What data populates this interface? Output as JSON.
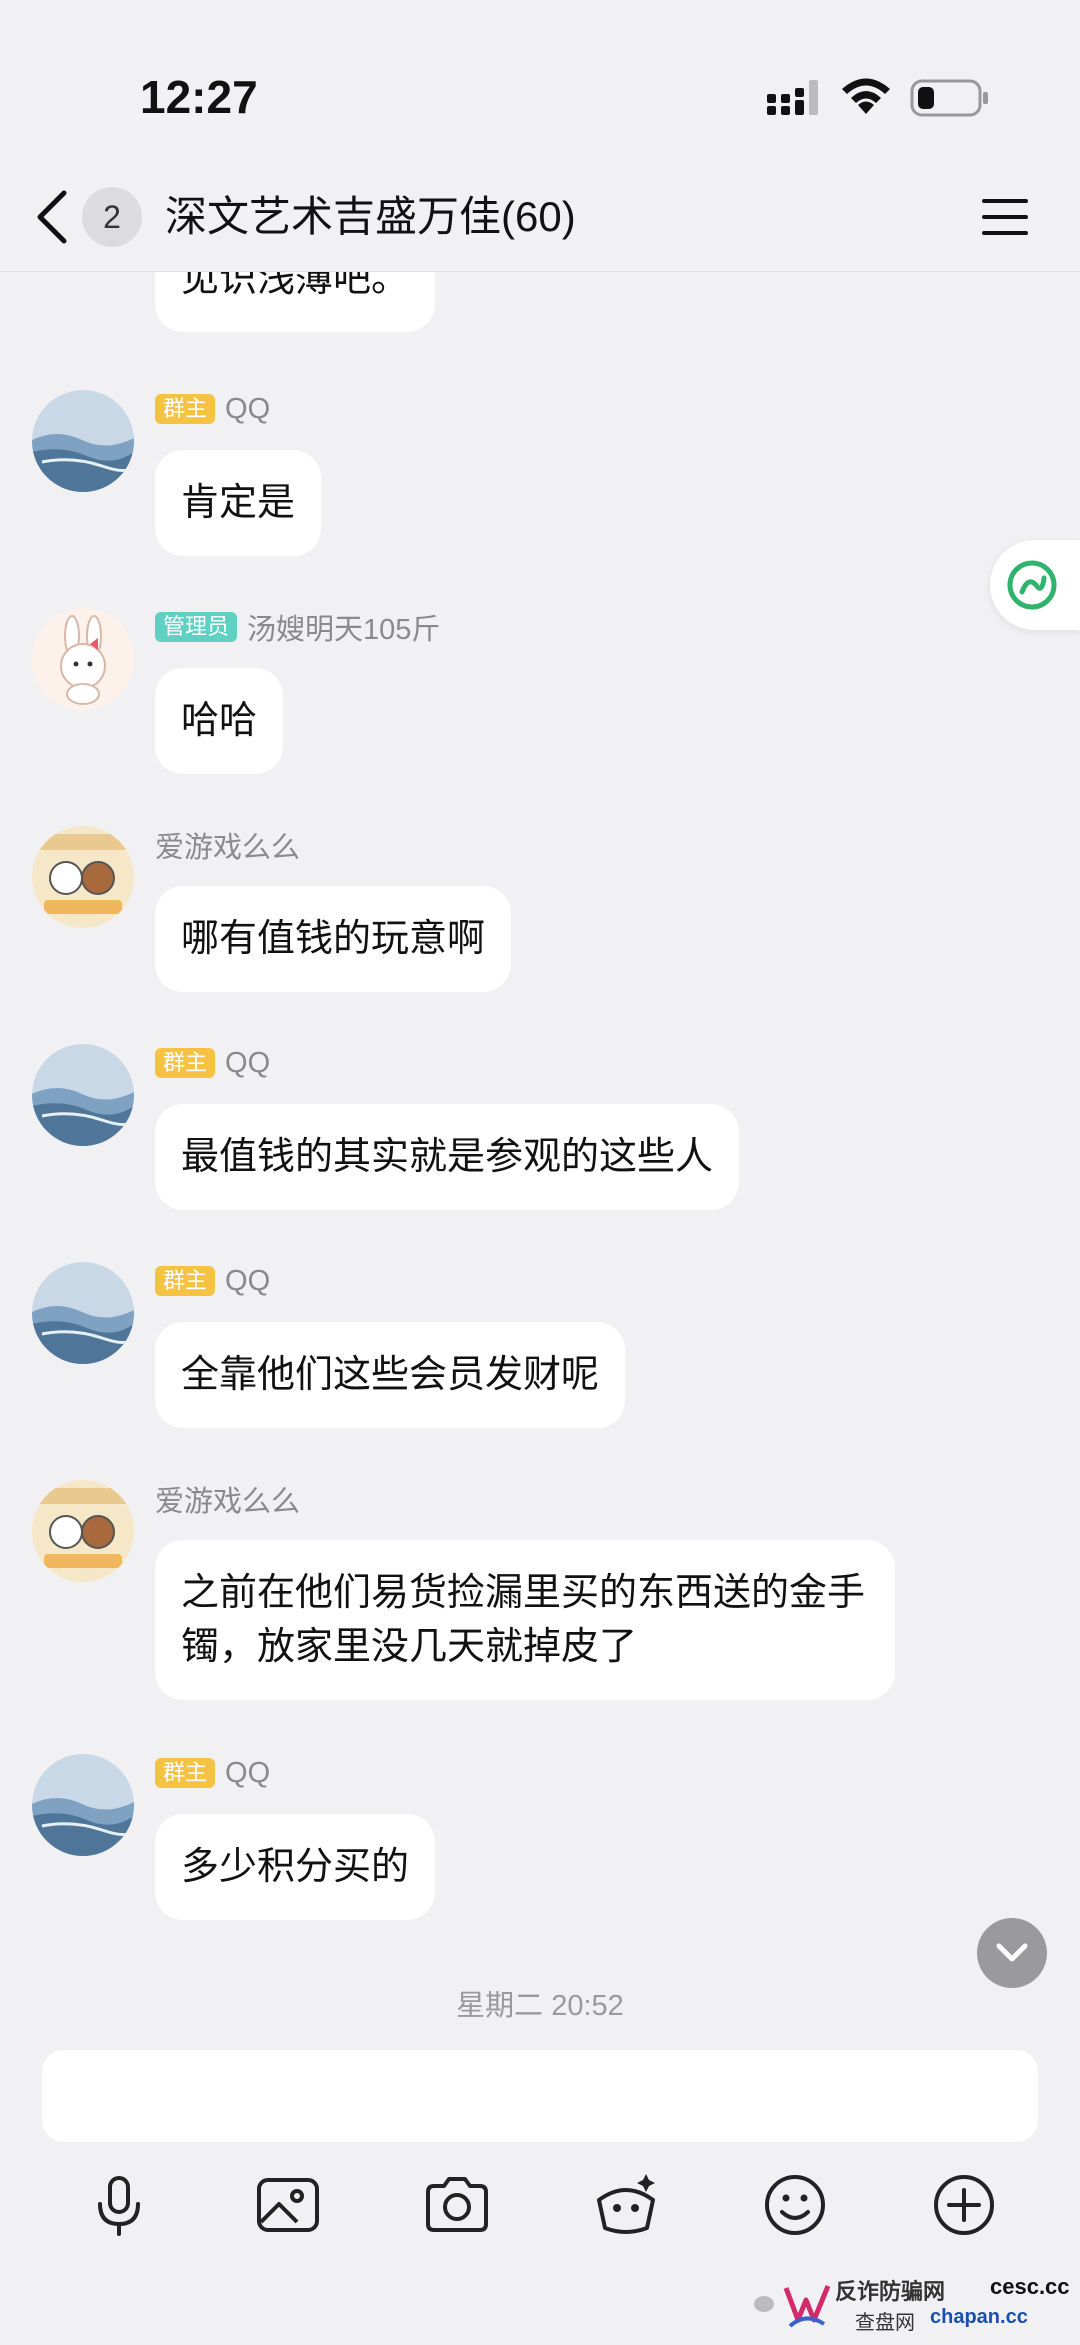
{
  "status_bar": {
    "time": "12:27"
  },
  "header": {
    "unread_count": "2",
    "title": "深文艺术吉盛万佳(60)"
  },
  "messages": [
    {
      "text": "见识浅薄吧。"
    },
    {
      "role": "群主",
      "sender": "QQ",
      "text": "肯定是"
    },
    {
      "role": "管理员",
      "sender": "汤嫂明天105斤",
      "text": "哈哈"
    },
    {
      "sender": "爱游戏么么",
      "text": "哪有值钱的玩意啊"
    },
    {
      "role": "群主",
      "sender": "QQ",
      "text": "最值钱的其实就是参观的这些人"
    },
    {
      "role": "群主",
      "sender": "QQ",
      "text": "全靠他们这些会员发财呢"
    },
    {
      "sender": "爱游戏么么",
      "text": "之前在他们易货捡漏里买的东西送的金手镯，放家里没几天就掉皮了"
    },
    {
      "role": "群主",
      "sender": "QQ",
      "text": "多少积分买的"
    }
  ],
  "timestamp": "星期二 20:52",
  "input": {
    "placeholder": ""
  },
  "toolbar": {
    "icons": [
      "microphone-icon",
      "image-icon",
      "camera-icon",
      "red-packet-icon",
      "emoji-icon",
      "plus-icon"
    ]
  },
  "watermark": {
    "line1": "反诈防骗网",
    "line1b": "cesc.cc",
    "line2": "查盘网",
    "line2b": "chapan.cc"
  },
  "colors": {
    "background": "#f1f1f3",
    "owner_badge": "#f6c244",
    "admin_badge": "#5fd0c2",
    "bubble": "#ffffff"
  }
}
